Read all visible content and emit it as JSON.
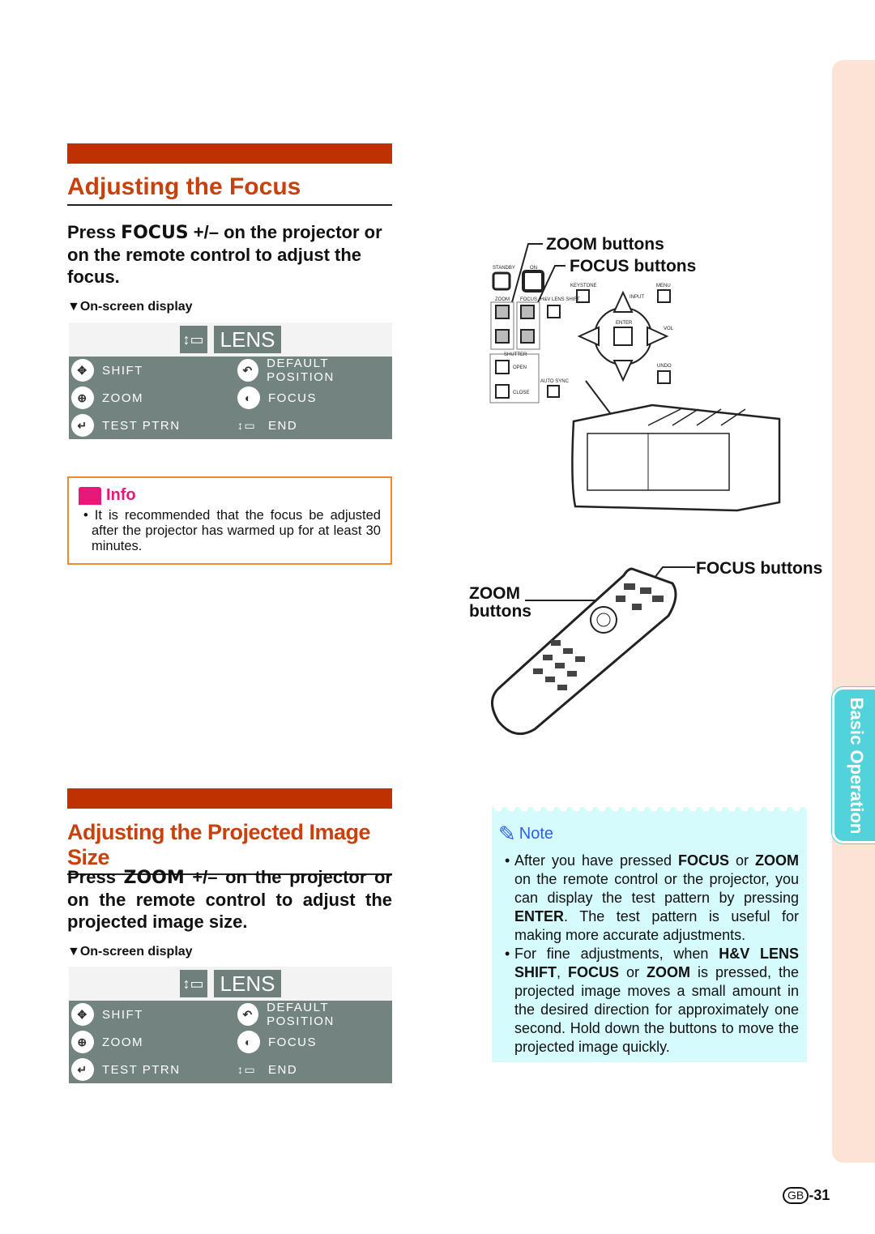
{
  "section1": {
    "title": "Adjusting the Focus",
    "instr_a": "Press ",
    "instr_key": "FOCUS",
    "instr_b": " +/– on the projector or on the remote control to adjust the focus.",
    "osd_label": "▼On-screen display"
  },
  "section2": {
    "title": "Adjusting the Projected Image Size",
    "instr_a": "Press ",
    "instr_key": "ZOOM",
    "instr_b": " +/– on the projector or on the remote control to adjust the projected image size.",
    "osd_label": "▼On-screen display"
  },
  "osd": {
    "title": "LENS",
    "items": [
      "SHIFT",
      "DEFAULT POSITION",
      "ZOOM",
      "FOCUS",
      "TEST PTRN",
      "END"
    ]
  },
  "info": {
    "heading": "Info",
    "text": "It is recommended that the focus be adjusted after the projector has warmed up for at least 30 minutes."
  },
  "panel": {
    "zoom_label": "ZOOM buttons",
    "focus_label": "FOCUS buttons",
    "keys": [
      "STANDBY",
      "ON",
      "ZOOM",
      "FOCUS",
      "H&V LENS SHIFT",
      "KEYSTONE",
      "MENU",
      "INPUT",
      "ENTER",
      "VOL",
      "UNDO",
      "SHUTTER",
      "OPEN",
      "CLOSE",
      "AUTO SYNC"
    ]
  },
  "remote": {
    "focus_label": "FOCUS buttons",
    "zoom_label": "ZOOM buttons"
  },
  "note": {
    "heading": "Note",
    "items": [
      [
        "After you have pressed ",
        "FOCUS",
        " or ",
        "ZOOM",
        " on the remote control or the projector, you can display the test pattern by pressing ",
        "ENTER",
        ". The test pattern is useful for making more accurate adjustments."
      ],
      [
        "For fine adjustments, when ",
        "H&V LENS SHIFT",
        ", ",
        "FOCUS",
        " or ",
        "ZOOM",
        " is pressed, the projected image moves a small amount in the desired direction for approximately one second. Hold down the buttons to move the projected image quickly."
      ]
    ]
  },
  "side_tab": "Basic Operation",
  "page": {
    "region": "GB",
    "number": "-31"
  },
  "colors": {
    "accent": "#BF3100",
    "title": "#C8400C",
    "note_bg": "#D5FBFD",
    "tab": "#52D2DA",
    "side": "#FDE3D6"
  }
}
